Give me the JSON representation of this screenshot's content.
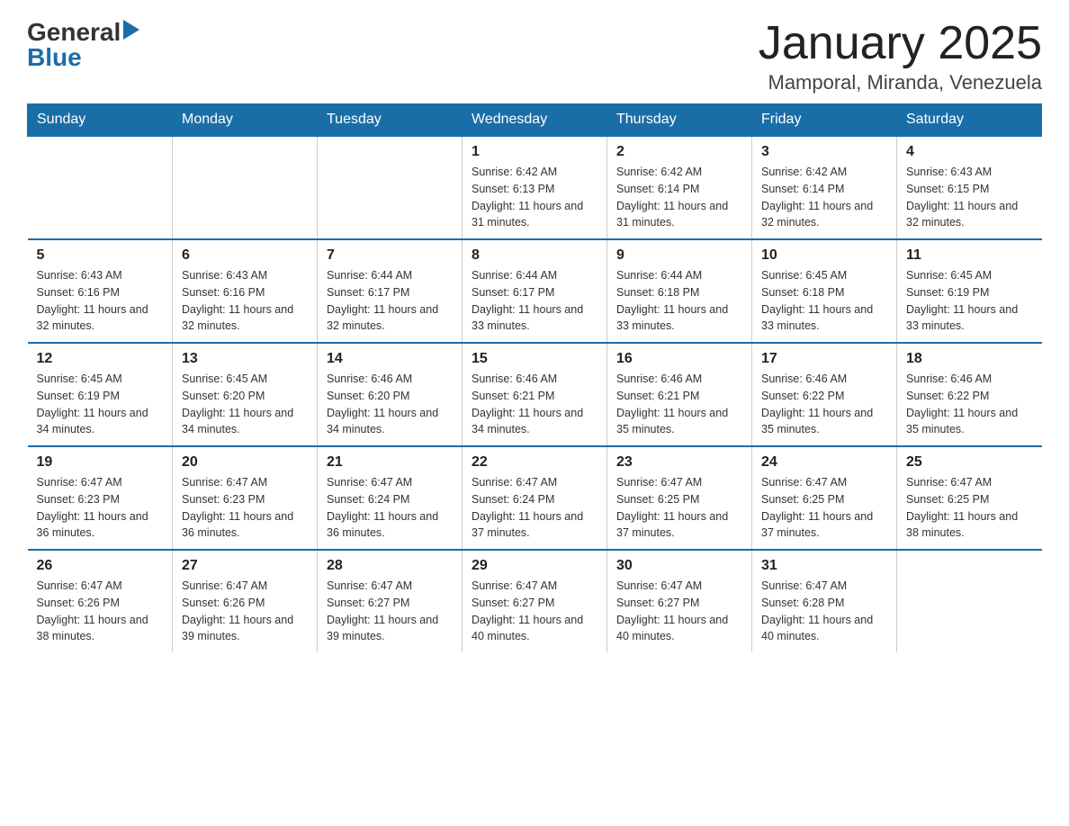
{
  "logo": {
    "general": "General",
    "blue": "Blue",
    "arrow_char": "▶"
  },
  "title": "January 2025",
  "subtitle": "Mamporal, Miranda, Venezuela",
  "days_of_week": [
    "Sunday",
    "Monday",
    "Tuesday",
    "Wednesday",
    "Thursday",
    "Friday",
    "Saturday"
  ],
  "weeks": [
    [
      {
        "day": "",
        "info": ""
      },
      {
        "day": "",
        "info": ""
      },
      {
        "day": "",
        "info": ""
      },
      {
        "day": "1",
        "info": "Sunrise: 6:42 AM\nSunset: 6:13 PM\nDaylight: 11 hours and 31 minutes."
      },
      {
        "day": "2",
        "info": "Sunrise: 6:42 AM\nSunset: 6:14 PM\nDaylight: 11 hours and 31 minutes."
      },
      {
        "day": "3",
        "info": "Sunrise: 6:42 AM\nSunset: 6:14 PM\nDaylight: 11 hours and 32 minutes."
      },
      {
        "day": "4",
        "info": "Sunrise: 6:43 AM\nSunset: 6:15 PM\nDaylight: 11 hours and 32 minutes."
      }
    ],
    [
      {
        "day": "5",
        "info": "Sunrise: 6:43 AM\nSunset: 6:16 PM\nDaylight: 11 hours and 32 minutes."
      },
      {
        "day": "6",
        "info": "Sunrise: 6:43 AM\nSunset: 6:16 PM\nDaylight: 11 hours and 32 minutes."
      },
      {
        "day": "7",
        "info": "Sunrise: 6:44 AM\nSunset: 6:17 PM\nDaylight: 11 hours and 32 minutes."
      },
      {
        "day": "8",
        "info": "Sunrise: 6:44 AM\nSunset: 6:17 PM\nDaylight: 11 hours and 33 minutes."
      },
      {
        "day": "9",
        "info": "Sunrise: 6:44 AM\nSunset: 6:18 PM\nDaylight: 11 hours and 33 minutes."
      },
      {
        "day": "10",
        "info": "Sunrise: 6:45 AM\nSunset: 6:18 PM\nDaylight: 11 hours and 33 minutes."
      },
      {
        "day": "11",
        "info": "Sunrise: 6:45 AM\nSunset: 6:19 PM\nDaylight: 11 hours and 33 minutes."
      }
    ],
    [
      {
        "day": "12",
        "info": "Sunrise: 6:45 AM\nSunset: 6:19 PM\nDaylight: 11 hours and 34 minutes."
      },
      {
        "day": "13",
        "info": "Sunrise: 6:45 AM\nSunset: 6:20 PM\nDaylight: 11 hours and 34 minutes."
      },
      {
        "day": "14",
        "info": "Sunrise: 6:46 AM\nSunset: 6:20 PM\nDaylight: 11 hours and 34 minutes."
      },
      {
        "day": "15",
        "info": "Sunrise: 6:46 AM\nSunset: 6:21 PM\nDaylight: 11 hours and 34 minutes."
      },
      {
        "day": "16",
        "info": "Sunrise: 6:46 AM\nSunset: 6:21 PM\nDaylight: 11 hours and 35 minutes."
      },
      {
        "day": "17",
        "info": "Sunrise: 6:46 AM\nSunset: 6:22 PM\nDaylight: 11 hours and 35 minutes."
      },
      {
        "day": "18",
        "info": "Sunrise: 6:46 AM\nSunset: 6:22 PM\nDaylight: 11 hours and 35 minutes."
      }
    ],
    [
      {
        "day": "19",
        "info": "Sunrise: 6:47 AM\nSunset: 6:23 PM\nDaylight: 11 hours and 36 minutes."
      },
      {
        "day": "20",
        "info": "Sunrise: 6:47 AM\nSunset: 6:23 PM\nDaylight: 11 hours and 36 minutes."
      },
      {
        "day": "21",
        "info": "Sunrise: 6:47 AM\nSunset: 6:24 PM\nDaylight: 11 hours and 36 minutes."
      },
      {
        "day": "22",
        "info": "Sunrise: 6:47 AM\nSunset: 6:24 PM\nDaylight: 11 hours and 37 minutes."
      },
      {
        "day": "23",
        "info": "Sunrise: 6:47 AM\nSunset: 6:25 PM\nDaylight: 11 hours and 37 minutes."
      },
      {
        "day": "24",
        "info": "Sunrise: 6:47 AM\nSunset: 6:25 PM\nDaylight: 11 hours and 37 minutes."
      },
      {
        "day": "25",
        "info": "Sunrise: 6:47 AM\nSunset: 6:25 PM\nDaylight: 11 hours and 38 minutes."
      }
    ],
    [
      {
        "day": "26",
        "info": "Sunrise: 6:47 AM\nSunset: 6:26 PM\nDaylight: 11 hours and 38 minutes."
      },
      {
        "day": "27",
        "info": "Sunrise: 6:47 AM\nSunset: 6:26 PM\nDaylight: 11 hours and 39 minutes."
      },
      {
        "day": "28",
        "info": "Sunrise: 6:47 AM\nSunset: 6:27 PM\nDaylight: 11 hours and 39 minutes."
      },
      {
        "day": "29",
        "info": "Sunrise: 6:47 AM\nSunset: 6:27 PM\nDaylight: 11 hours and 40 minutes."
      },
      {
        "day": "30",
        "info": "Sunrise: 6:47 AM\nSunset: 6:27 PM\nDaylight: 11 hours and 40 minutes."
      },
      {
        "day": "31",
        "info": "Sunrise: 6:47 AM\nSunset: 6:28 PM\nDaylight: 11 hours and 40 minutes."
      },
      {
        "day": "",
        "info": ""
      }
    ]
  ]
}
